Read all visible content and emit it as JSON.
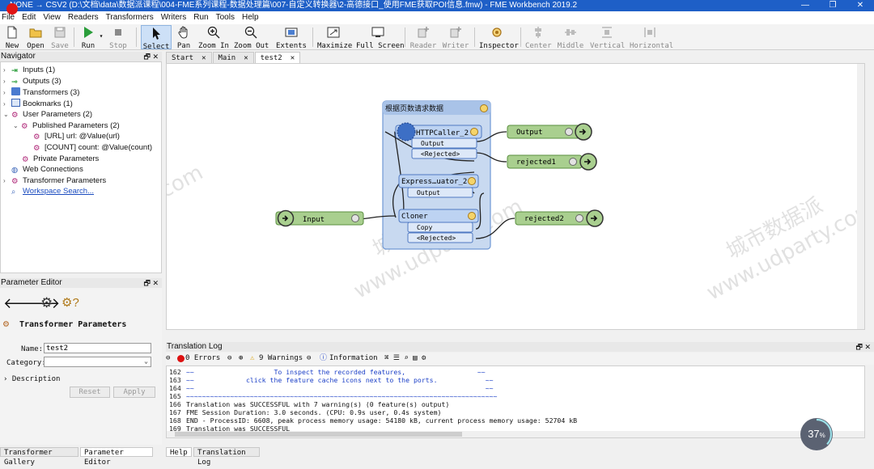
{
  "window": {
    "title": "NONE → CSV2 (D:\\文档\\data\\数据派课程\\004-FME系列课程-数据处理篇\\007-自定义转换器\\2-高德接口_使用FME获取POI信息.fmw) - FME Workbench 2019.2"
  },
  "menu": [
    "File",
    "Edit",
    "View",
    "Readers",
    "Transformers",
    "Writers",
    "Run",
    "Tools",
    "Help"
  ],
  "toolbar": {
    "new": "New",
    "open": "Open",
    "save": "Save",
    "run": "Run",
    "stop": "Stop",
    "select": "Select",
    "pan": "Pan",
    "zoom_in": "Zoom In",
    "zoom_out": "Zoom Out",
    "extents": "Extents",
    "maximize": "Maximize",
    "full_screen": "Full Screen",
    "reader": "Reader",
    "writer": "Writer",
    "inspector": "Inspector",
    "center": "Center",
    "middle": "Middle",
    "vertical": "Vertical",
    "horizontal": "Horizontal"
  },
  "tabs": [
    "Start",
    "Main",
    "test2"
  ],
  "navigator": {
    "title": "Navigator",
    "items": {
      "inputs": "Inputs (1)",
      "outputs": "Outputs (3)",
      "transformers": "Transformers (3)",
      "bookmarks": "Bookmarks (1)",
      "user_params": "User Parameters (2)",
      "published": "Published Parameters (2)",
      "url": "[URL] url: @Value(url)",
      "count": "[COUNT] count: @Value(count)",
      "private": "Private Parameters",
      "web": "Web Connections",
      "transformer_params": "Transformer Parameters",
      "search": "Workspace Search..."
    }
  },
  "param_editor": {
    "title": "Parameter Editor",
    "heading": "Transformer Parameters",
    "name_label": "Name:",
    "name_value": "test2",
    "category_label": "Category:",
    "description": "Description",
    "reset": "Reset",
    "apply": "Apply"
  },
  "bottom_tabs_left": [
    "Transformer Gallery",
    "Parameter Editor"
  ],
  "bottom_tabs_right": [
    "Help",
    "Translation Log"
  ],
  "canvas": {
    "bookmark": "根据页数请求数据",
    "input": "Input",
    "http": "HTTPCaller_2",
    "http_output": "Output",
    "http_rejected": "<Rejected>",
    "expr": "Express…uator_2",
    "expr_output": "Output",
    "cloner": "Cloner",
    "cloner_copy": "Copy",
    "cloner_rejected": "<Rejected>",
    "out_output": "Output",
    "out_rejected1": "rejected1",
    "out_rejected2": "rejected2",
    "watermark1": "城市数据派",
    "watermark2": "www.udparty.com"
  },
  "log": {
    "title": "Translation Log",
    "errors": "0 Errors",
    "warnings": "9 Warnings",
    "information": "Information",
    "lines": [
      {
        "n": "162",
        "t": "~~                    To inspect the recorded features,                  ~~",
        "blue": true
      },
      {
        "n": "163",
        "t": "~~             click the feature cache icons next to the ports.            ~~",
        "blue": true
      },
      {
        "n": "164",
        "t": "~~                                                                         ~~",
        "blue": true
      },
      {
        "n": "165",
        "t": "~~~~~~~~~~~~~~~~~~~~~~~~~~~~~~~~~~~~~~~~~~~~~~~~~~~~~~~~~~~~~~~~~~~~~~~~~~~~~~",
        "blue": true
      },
      {
        "n": "166",
        "t": "Translation was SUCCESSFUL with 7 warning(s) (0 feature(s) output)",
        "blue": false
      },
      {
        "n": "167",
        "t": "FME Session Duration: 3.0 seconds. (CPU: 0.9s user, 0.4s system)",
        "blue": false
      },
      {
        "n": "168",
        "t": "END - ProcessID: 6608, peak process memory usage: 54180 kB, current process memory usage: 52704 kB",
        "blue": false
      },
      {
        "n": "169",
        "t": "Translation was SUCCESSFUL",
        "blue": false
      }
    ]
  },
  "progress": {
    "label": "37",
    "unit": "%",
    "value": 0.37
  }
}
